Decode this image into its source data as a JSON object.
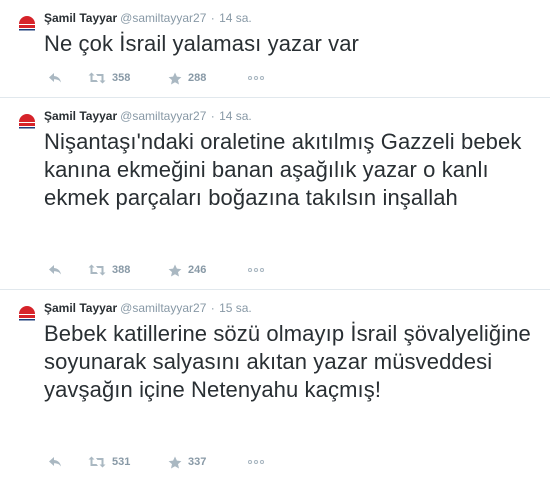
{
  "tweets": [
    {
      "fullname": "Şamil Tayyar",
      "username": "@samiltayyar27",
      "separator": "·",
      "time": "14 sa.",
      "text": "Ne çok İsrail yalaması yazar var",
      "retweets": "358",
      "favorites": "288"
    },
    {
      "fullname": "Şamil Tayyar",
      "username": "@samiltayyar27",
      "separator": "·",
      "time": "14 sa.",
      "text": "Nişantaşı'ndaki oraletine akıtılmış Gazzeli bebek kanına ekmeğini banan aşağılık yazar o kanlı ekmek parçaları boğazına takılsın inşallah",
      "retweets": "388",
      "favorites": "246"
    },
    {
      "fullname": "Şamil Tayyar",
      "username": "@samiltayyar27",
      "separator": "·",
      "time": "15 sa.",
      "text": "Bebek katillerine sözü olmayıp İsrail şövalyeliğine soyunarak salyasını akıtan yazar müsveddesi yavşağın içine Netenyahu kaçmış!",
      "retweets": "531",
      "favorites": "337"
    }
  ],
  "icons": {
    "avatar": "doğan-logo-icon",
    "reply": "reply-icon",
    "retweet": "retweet-icon",
    "favorite": "star-icon",
    "more": "more-icon"
  },
  "colors": {
    "text": "#292f33",
    "muted": "#8899a6",
    "divider": "#e1e8ed",
    "avatar_red": "#d6232a"
  }
}
